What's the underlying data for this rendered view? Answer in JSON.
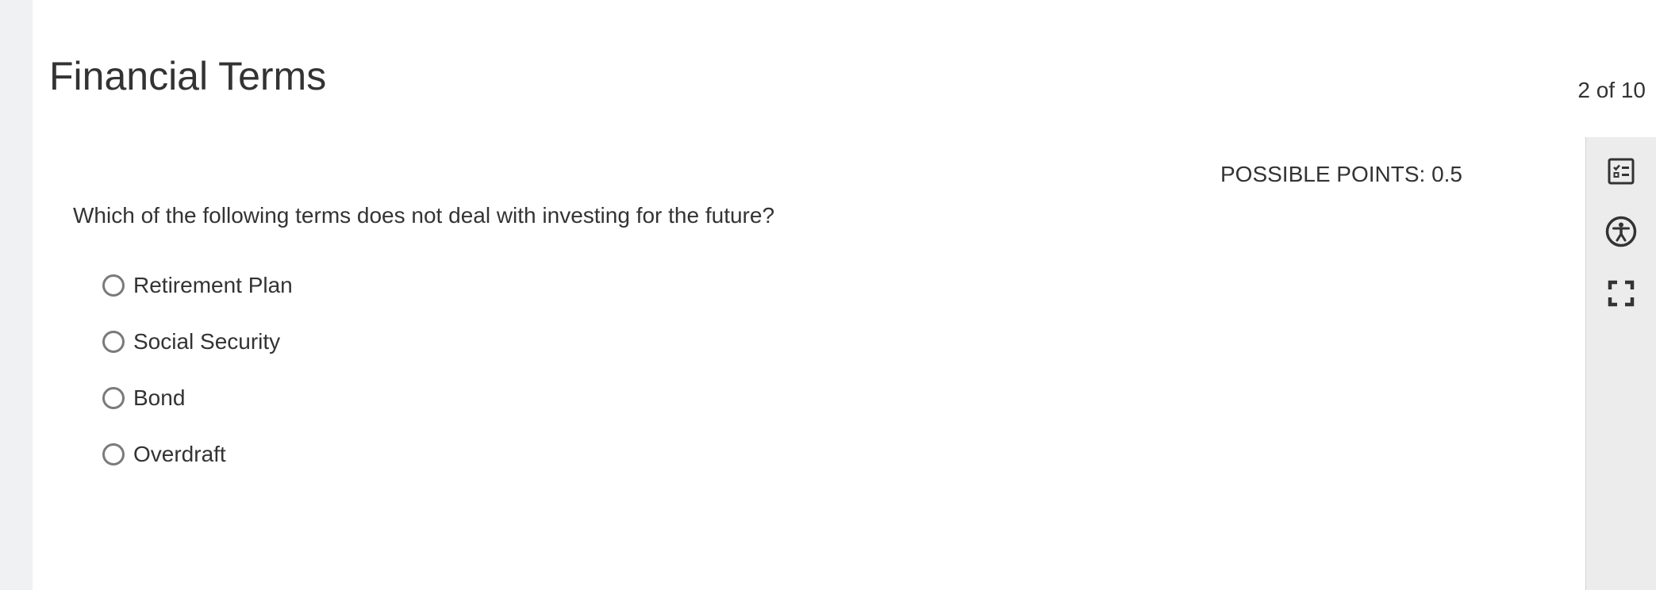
{
  "quiz": {
    "title": "Financial Terms",
    "counter": "2 of 10",
    "points": "POSSIBLE POINTS: 0.5",
    "question": "Which of the following terms does not deal with investing for the future?",
    "options": [
      {
        "label": "Retirement Plan",
        "selected": false
      },
      {
        "label": "Social Security",
        "selected": false
      },
      {
        "label": "Bond",
        "selected": false
      },
      {
        "label": "Overdraft",
        "selected": false
      }
    ]
  },
  "toolbar": {
    "tools": [
      {
        "icon": "question-list-icon"
      },
      {
        "icon": "accessibility-icon"
      },
      {
        "icon": "fullscreen-icon"
      }
    ]
  },
  "colors": {
    "text": "#333333",
    "left_rail": "#f0f1f2",
    "toolbar_bg": "#ececec",
    "radio_border": "#7a7a7a"
  }
}
